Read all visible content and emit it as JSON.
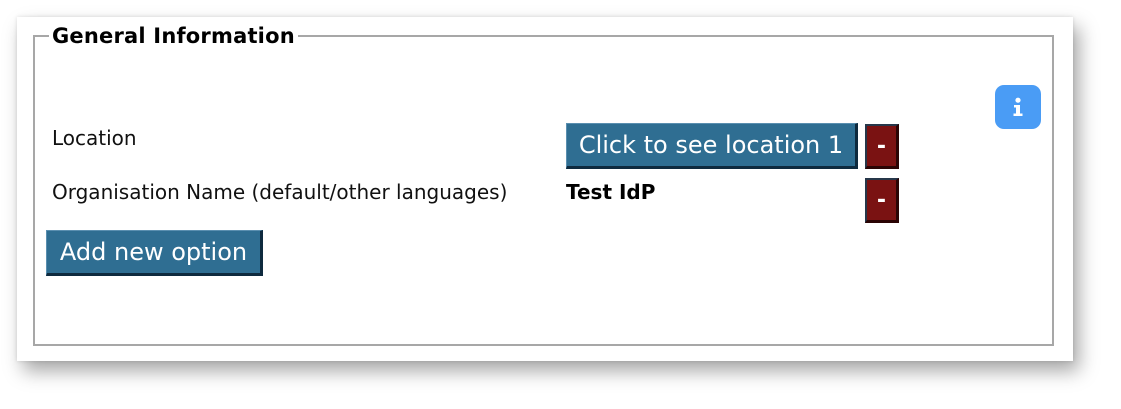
{
  "section": {
    "legend": "General Information"
  },
  "info_button": {
    "icon": "info-icon"
  },
  "rows": {
    "location": {
      "label": "Location",
      "button_label": "Click to see location 1",
      "remove_label": "-"
    },
    "organisation": {
      "label": "Organisation Name (default/other languages)",
      "value": "Test IdP",
      "remove_label": "-"
    }
  },
  "add_button": {
    "label": "Add new option"
  },
  "colors": {
    "primary_button": "#2f6e92",
    "remove_button": "#7a1212",
    "info_button": "#4a9cf5",
    "border": "#a7a7a7"
  }
}
